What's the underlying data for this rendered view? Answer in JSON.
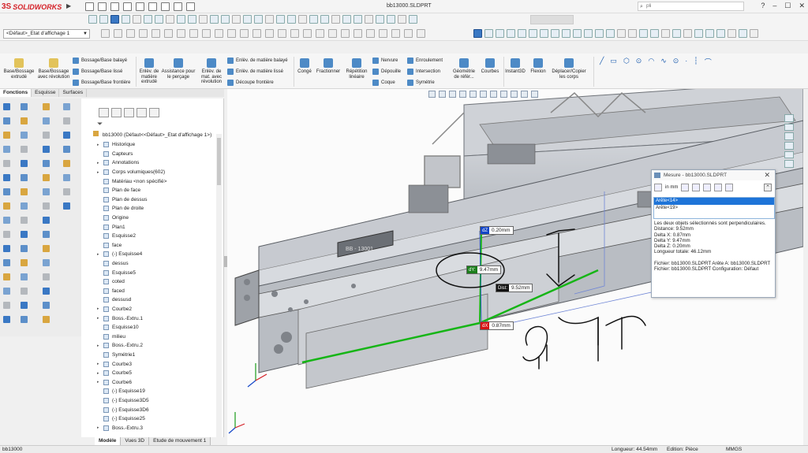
{
  "app": {
    "brand_ds": "3S",
    "brand_name": "SOLIDWORKS",
    "doc_title": "bb13000.SLDPRT",
    "search_placeholder": "pli",
    "win_controls": [
      "?",
      "–",
      "☐",
      "✕"
    ]
  },
  "config_select": "<Défaut>_Etat d'affichage 1",
  "ribbon": {
    "large_buttons": [
      {
        "label": "Base/Bossage extrudé"
      },
      {
        "label": "Base/Bossage avec révolution"
      },
      {
        "label": "Enlèv. de matière extrudé"
      },
      {
        "label": "Assistance pour le perçage"
      },
      {
        "label": "Enlèv. de mat. avec révolution"
      },
      {
        "label": "Congé"
      },
      {
        "label": "Fractionner"
      },
      {
        "label": "Répétition linéaire"
      },
      {
        "label": "Géométrie de référ..."
      },
      {
        "label": "Courbes"
      },
      {
        "label": "Instant3D"
      },
      {
        "label": "Flexion"
      },
      {
        "label": "Déplacer/Copier les corps"
      }
    ],
    "small_buttons": [
      {
        "label": "Bossage/Base balayé"
      },
      {
        "label": "Bossage/Base lissé"
      },
      {
        "label": "Bossage/Base frontière"
      },
      {
        "label": "Enlèv. de matière balayé"
      },
      {
        "label": "Enlèv. de matière lissé"
      },
      {
        "label": "Découpe frontière"
      },
      {
        "label": "Nervure"
      },
      {
        "label": "Dépouille"
      },
      {
        "label": "Coque"
      },
      {
        "label": "Enroulement"
      },
      {
        "label": "Intersection"
      },
      {
        "label": "Symétrie"
      }
    ]
  },
  "tabs": [
    "Fonctions",
    "Esquisse",
    "Surfaces"
  ],
  "tree": {
    "root": "bb13000  (Défaut<<Défaut>_Etat d'affichage 1>)",
    "items": [
      {
        "label": "Historique",
        "expand": "▸"
      },
      {
        "label": "Capteurs",
        "expand": ""
      },
      {
        "label": "Annotations",
        "expand": "▸"
      },
      {
        "label": "Corps volumiques(602)",
        "expand": "▸"
      },
      {
        "label": "Matériau <non spécifié>",
        "expand": ""
      },
      {
        "label": "Plan de face",
        "expand": ""
      },
      {
        "label": "Plan de dessus",
        "expand": ""
      },
      {
        "label": "Plan de droite",
        "expand": ""
      },
      {
        "label": "Origine",
        "expand": ""
      },
      {
        "label": "Plan1",
        "expand": ""
      },
      {
        "label": "Esquisse2",
        "expand": ""
      },
      {
        "label": "face",
        "expand": ""
      },
      {
        "label": "(-) Esquisse4",
        "expand": "▸"
      },
      {
        "label": "dessus",
        "expand": ""
      },
      {
        "label": "Esquisse5",
        "expand": ""
      },
      {
        "label": "coted",
        "expand": ""
      },
      {
        "label": "faced",
        "expand": ""
      },
      {
        "label": "dessusd",
        "expand": ""
      },
      {
        "label": "Courbe2",
        "expand": "▸"
      },
      {
        "label": "Boss.-Extru.1",
        "expand": "▸"
      },
      {
        "label": "Esquisse10",
        "expand": ""
      },
      {
        "label": "milieu",
        "expand": ""
      },
      {
        "label": "Boss.-Extru.2",
        "expand": "▸"
      },
      {
        "label": "Symétrie1",
        "expand": ""
      },
      {
        "label": "Courbe3",
        "expand": "▸"
      },
      {
        "label": "Courbe5",
        "expand": "▸"
      },
      {
        "label": "Courbe6",
        "expand": "▸"
      },
      {
        "label": "(-) Esquisse19",
        "expand": ""
      },
      {
        "label": "(-) Esquisse3D5",
        "expand": ""
      },
      {
        "label": "(-) Esquisse3D6",
        "expand": ""
      },
      {
        "label": "(-) Esquisse25",
        "expand": ""
      },
      {
        "label": "Boss.-Extru.3",
        "expand": "▸"
      }
    ]
  },
  "model_tabs": [
    "Modèle",
    "Vues 3D",
    "Etude de mouvement 1"
  ],
  "status": {
    "left": "bb13000",
    "length": "Longueur: 44.54mm",
    "editing": "Edition: Pièce",
    "units": "MMGS"
  },
  "measure": {
    "title": "Mesure - bb13000.SLDPRT",
    "unit_label": "in mm",
    "selections": [
      "Arête<14>",
      "Arête<19>"
    ],
    "results": [
      "Les deux objets sélectionnés sont perpendiculaires.",
      "Distance: 9.52mm",
      "Delta X: 0.87mm",
      "Delta Y: 9.47mm",
      "Delta Z: 0.20mm",
      "Longueur totale: 46.12mm",
      "",
      "Fichier: bb13000.SLDPRT Arête A: bb13000.SLDPRT",
      "Fichier: bb13000.SLDPRT Configuration: Défaut"
    ]
  },
  "dimensions": {
    "dz": {
      "tag": "dZ",
      "value": "0.20mm"
    },
    "dy": {
      "tag": "dY:",
      "value": "9.47mm"
    },
    "dist": {
      "tag": "Dist:",
      "value": "9.52mm"
    },
    "dx": {
      "tag": "dX",
      "value": "0.87mm"
    }
  },
  "colors": {
    "brand_red": "#d41f26",
    "selection_green": "#16b516",
    "dz_blue": "#1446c8",
    "dy_green": "#1a7d1a",
    "dx_red": "#d61414",
    "highlight_blue": "#1e74d8",
    "model_gray": "#c6c9cf"
  }
}
